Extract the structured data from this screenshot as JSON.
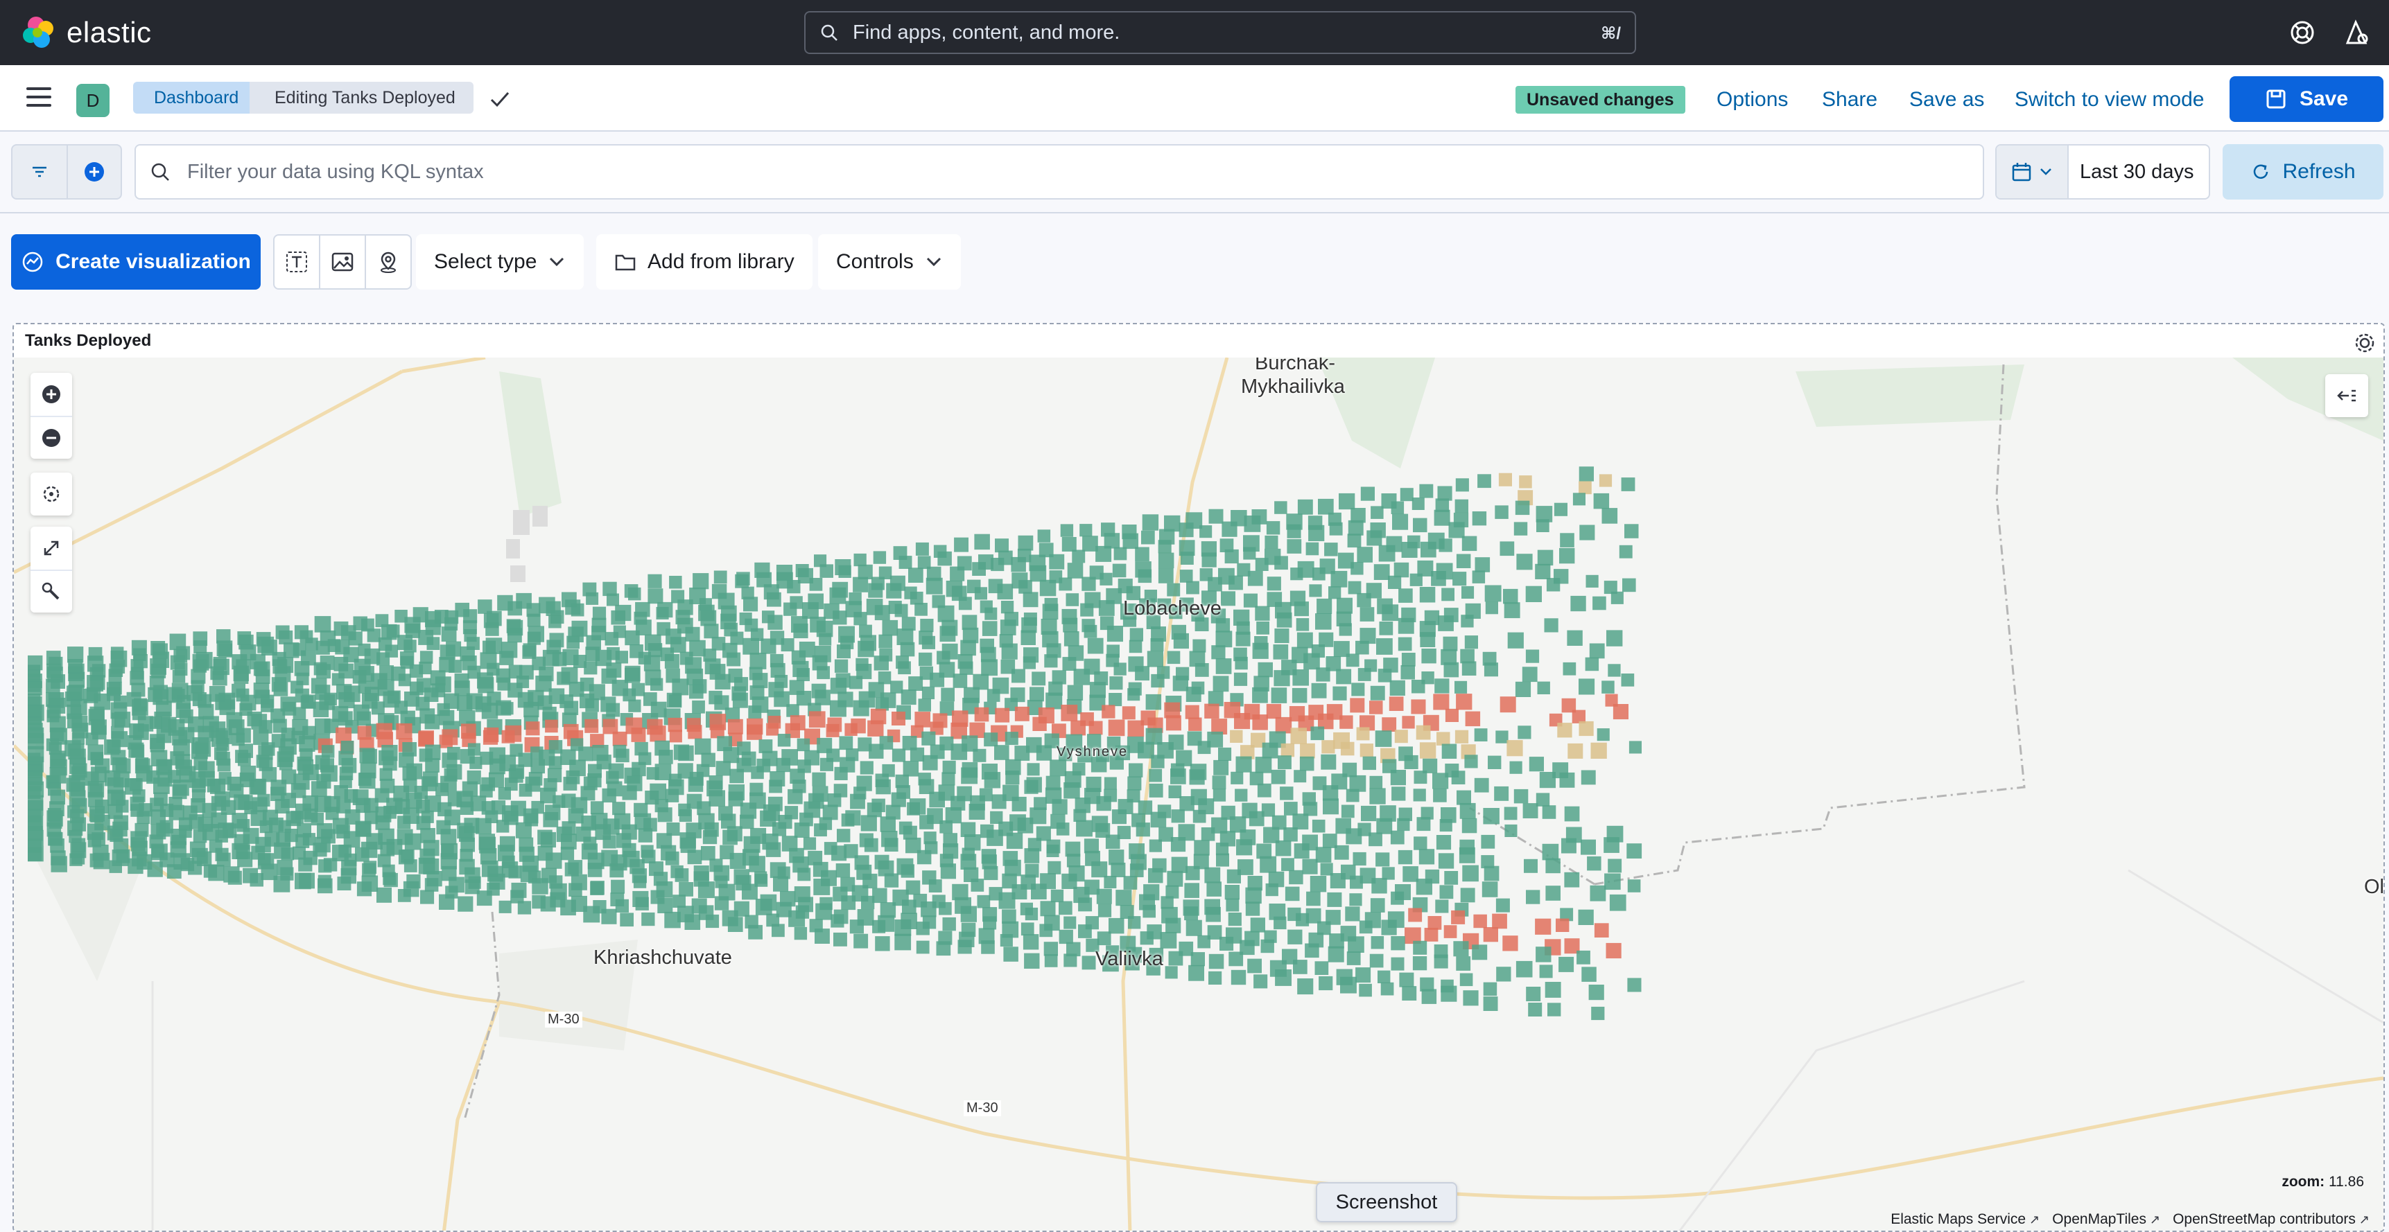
{
  "app": {
    "name": "elastic"
  },
  "header": {
    "search_placeholder": "Find apps, content, and more.",
    "search_shortcut": "⌘/"
  },
  "breadcrumbs": {
    "avatar_letter": "D",
    "items": [
      "Dashboard",
      "Editing Tanks Deployed"
    ]
  },
  "top_actions": {
    "status_badge": "Unsaved changes",
    "options": "Options",
    "share": "Share",
    "save_as": "Save as",
    "switch_mode": "Switch to view mode",
    "save": "Save"
  },
  "query": {
    "placeholder": "Filter your data using KQL syntax",
    "time_range": "Last 30 days",
    "refresh": "Refresh"
  },
  "toolbar": {
    "create": "Create visualization",
    "select_type": "Select type",
    "add_from_library": "Add from library",
    "controls": "Controls"
  },
  "panel": {
    "title": "Tanks Deployed",
    "map": {
      "places": [
        "Burchak-",
        "Mykhailivka",
        "Lobacheve",
        "Vyshneve",
        "Khriashchuvate",
        "Valiivka",
        "Ol"
      ],
      "roads": [
        "M-30",
        "M-30"
      ],
      "zoom_label": "zoom:",
      "zoom_value": "11.86",
      "attribution": [
        "Elastic Maps Service",
        "OpenMapTiles",
        "OpenStreetMap contributors"
      ],
      "colors": {
        "primary": "#54a38a",
        "warm": "#d9c08a",
        "hot": "#e0705c"
      }
    }
  },
  "tooltip": {
    "screenshot": "Screenshot"
  }
}
